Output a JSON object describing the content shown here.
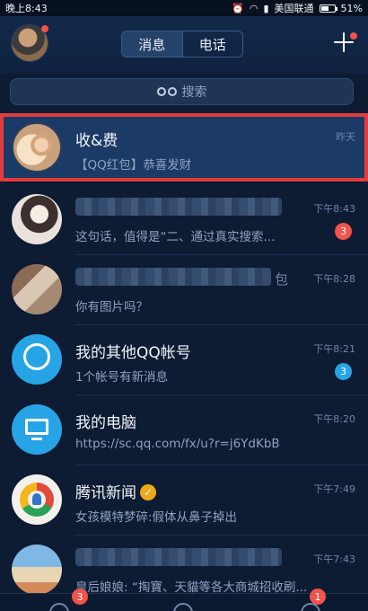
{
  "statusbar": {
    "time": "晚上8:43",
    "carrier": "美国联通",
    "battery": "51%",
    "alarm_icon": "alarm-icon",
    "wifi_icon": "wifi-icon",
    "signal_icon": "signal-icon"
  },
  "header": {
    "tabs": [
      {
        "label": "消息",
        "active": true
      },
      {
        "label": "电话",
        "active": false
      }
    ],
    "add_icon": "plus-icon"
  },
  "search": {
    "label": "搜索",
    "icon": "binoculars-icon"
  },
  "conversations": [
    {
      "name": "收&费",
      "message": "【QQ红包】恭喜发财",
      "time": "昨天",
      "badge": null,
      "highlighted": true
    },
    {
      "name": "",
      "message": "这句话，值得是“二、通过真实搜索...",
      "time": "下午8:43",
      "badge": "3",
      "badge_color": "red"
    },
    {
      "name": "包",
      "message": "你有图片吗？",
      "time": "下午8:28",
      "badge": null
    },
    {
      "name": "我的其他QQ帐号",
      "message": "1个帐号有新消息",
      "time": "下午8:21",
      "badge": "3",
      "badge_color": "blue"
    },
    {
      "name": "我的电脑",
      "message": "https://sc.qq.com/fx/u?r=j6YdKbB",
      "time": "下午8:20",
      "badge": null
    },
    {
      "name": "腾讯新闻",
      "message": "女孩模特梦碎:假体从鼻子掉出",
      "time": "下午7:49",
      "badge": null
    },
    {
      "name": "",
      "message": "皇后娘娘: “掏寶、天貓等各大商城招收刷...",
      "time": "下午7:43",
      "badge": null
    }
  ],
  "footer": {
    "badges": [
      "3",
      "1"
    ]
  },
  "colors": {
    "background": "#0d1b33",
    "highlight_border": "#e23c3c",
    "badge_red": "#f0544a",
    "badge_blue": "#26a4e6"
  }
}
